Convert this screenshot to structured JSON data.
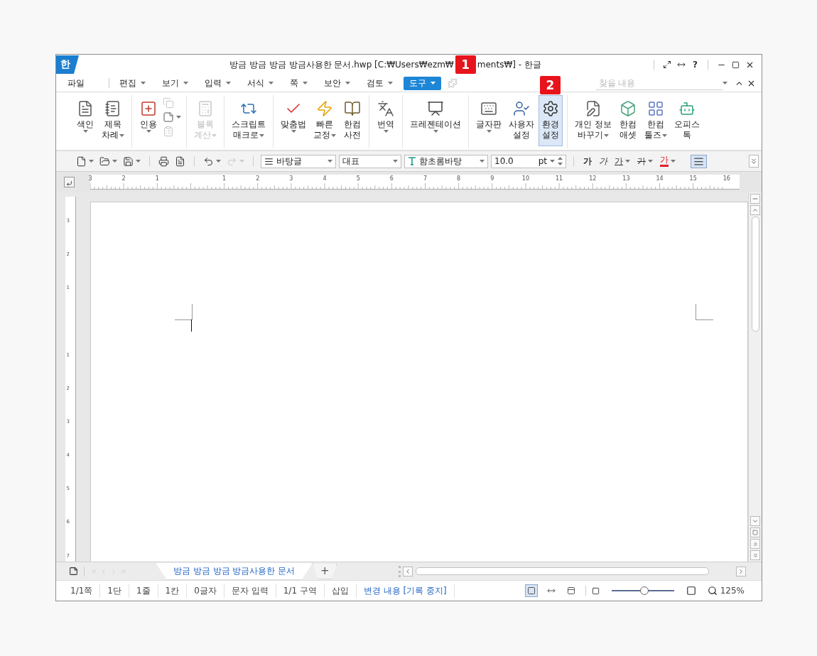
{
  "window": {
    "logo": "한",
    "title_before": "방금 방금 방금 방금사용한 문서.hwp [C:₩Users₩ezm₩",
    "callout": "1",
    "title_after": "ments₩] - 한글",
    "help": "?"
  },
  "menu": {
    "items": [
      {
        "label": "파일",
        "dropdown": false,
        "selected": false
      },
      {
        "label": "편집",
        "dropdown": true,
        "selected": false
      },
      {
        "label": "보기",
        "dropdown": true,
        "selected": false
      },
      {
        "label": "입력",
        "dropdown": true,
        "selected": false
      },
      {
        "label": "서식",
        "dropdown": true,
        "selected": false
      },
      {
        "label": "쪽",
        "dropdown": true,
        "selected": false
      },
      {
        "label": "보안",
        "dropdown": true,
        "selected": false
      },
      {
        "label": "검토",
        "dropdown": true,
        "selected": false
      },
      {
        "label": "도구",
        "dropdown": true,
        "selected": true
      }
    ],
    "extra_disabled": true,
    "search": {
      "placeholder": "찾을 내용"
    }
  },
  "ribbon": {
    "groups": [
      {
        "items": [
          {
            "kind": "large",
            "lines": [
              "색인"
            ],
            "dropdown": true,
            "disabled": false,
            "selected": false
          },
          {
            "kind": "large",
            "lines": [
              "제목",
              "차례"
            ],
            "dropdown": true,
            "disabled": false,
            "selected": false
          }
        ]
      },
      {
        "items": [
          {
            "kind": "large",
            "lines": [
              "인용"
            ],
            "dropdown": true,
            "disabled": false,
            "selected": false
          },
          {
            "kind": "stack",
            "buttons": [
              {
                "dropdown": false,
                "disabled": true
              },
              {
                "dropdown": true,
                "disabled": false
              },
              {
                "dropdown": false,
                "disabled": true
              }
            ]
          }
        ]
      },
      {
        "items": [
          {
            "kind": "large",
            "lines": [
              "블록",
              "계산"
            ],
            "dropdown": true,
            "disabled": true,
            "selected": false
          }
        ]
      },
      {
        "items": [
          {
            "kind": "large",
            "lines": [
              "스크립트",
              "매크로"
            ],
            "dropdown": true,
            "disabled": false,
            "selected": false
          }
        ]
      },
      {
        "items": [
          {
            "kind": "large",
            "lines": [
              "맞춤법"
            ],
            "dropdown": true,
            "disabled": false,
            "selected": false
          },
          {
            "kind": "large",
            "lines": [
              "빠른",
              "교정"
            ],
            "dropdown": true,
            "disabled": false,
            "selected": false
          },
          {
            "kind": "large",
            "lines": [
              "한컴",
              "사전"
            ],
            "dropdown": false,
            "disabled": false,
            "selected": false
          }
        ]
      },
      {
        "items": [
          {
            "kind": "large",
            "lines": [
              "번역"
            ],
            "dropdown": true,
            "disabled": false,
            "selected": false
          }
        ]
      },
      {
        "items": [
          {
            "kind": "large",
            "lines": [
              "프레젠테이션"
            ],
            "dropdown": true,
            "disabled": false,
            "selected": false
          }
        ]
      },
      {
        "items": [
          {
            "kind": "large",
            "lines": [
              "글자판"
            ],
            "dropdown": true,
            "disabled": false,
            "selected": false
          },
          {
            "kind": "large",
            "lines": [
              "사용자",
              "설정"
            ],
            "dropdown": false,
            "disabled": false,
            "selected": false
          },
          {
            "kind": "large",
            "lines": [
              "환경",
              "설정"
            ],
            "dropdown": false,
            "disabled": false,
            "selected": true,
            "callout": "2"
          }
        ]
      },
      {
        "items": [
          {
            "kind": "large",
            "lines": [
              "개인 정보",
              "바꾸기"
            ],
            "dropdown": true,
            "disabled": false,
            "selected": false
          },
          {
            "kind": "large",
            "lines": [
              "한컴",
              "애셋"
            ],
            "dropdown": false,
            "disabled": false,
            "selected": false
          },
          {
            "kind": "large",
            "lines": [
              "한컴",
              "툴즈"
            ],
            "dropdown": true,
            "disabled": false,
            "selected": false
          },
          {
            "kind": "large",
            "lines": [
              "오피스",
              "톡"
            ],
            "dropdown": false,
            "disabled": false,
            "selected": false
          }
        ]
      }
    ]
  },
  "format_bar": {
    "file_buttons": [
      {
        "dropdown": true,
        "disabled": false
      },
      {
        "dropdown": true,
        "disabled": false
      },
      {
        "dropdown": true,
        "disabled": false
      },
      {
        "dropdown": false,
        "disabled": false
      },
      {
        "dropdown": false,
        "disabled": false
      },
      {
        "dropdown": true,
        "disabled": false
      },
      {
        "dropdown": true,
        "disabled": true
      }
    ],
    "style": "바탕글",
    "outline": "대표",
    "font": "함초롬바탕",
    "size": "10.0",
    "unit": "pt",
    "char_buttons": [
      {
        "kind": "bold",
        "glyph": "가",
        "dropdown": false
      },
      {
        "kind": "italic",
        "glyph": "가",
        "dropdown": false
      },
      {
        "kind": "underline",
        "glyph": "가",
        "dropdown": true
      },
      {
        "kind": "strike",
        "glyph": "가",
        "dropdown": true
      },
      {
        "kind": "color",
        "glyph": "가",
        "dropdown": true,
        "color": "#e0202a"
      }
    ],
    "align": {
      "selected": true
    }
  },
  "ruler": {
    "labels": [
      "3",
      "2",
      "1",
      "1",
      "2",
      "3",
      "4",
      "5",
      "6",
      "7",
      "8",
      "9",
      "10",
      "11",
      "12",
      "13",
      "14",
      "15",
      "16"
    ]
  },
  "vertical_ruler": {
    "labels": [
      "3",
      "2",
      "1",
      "1",
      "2",
      "3",
      "4",
      "5",
      "6",
      "7"
    ]
  },
  "doc_tabs": {
    "tabs": [
      {
        "label": "방금 방금 방금 방금사용한 문서",
        "selected": true
      }
    ],
    "add": "+"
  },
  "status_bar": {
    "items": [
      "1/1쪽",
      "1단",
      "1줄",
      "1칸",
      "0글자",
      "문자 입력",
      "1/1 구역",
      "삽입"
    ],
    "track_changes": "변경 내용 [기록 중지]",
    "view_modes": [
      {
        "selected": true
      },
      {
        "selected": false
      },
      {
        "selected": false
      }
    ],
    "zoom": {
      "level": 0.53,
      "reading": "125%"
    }
  }
}
